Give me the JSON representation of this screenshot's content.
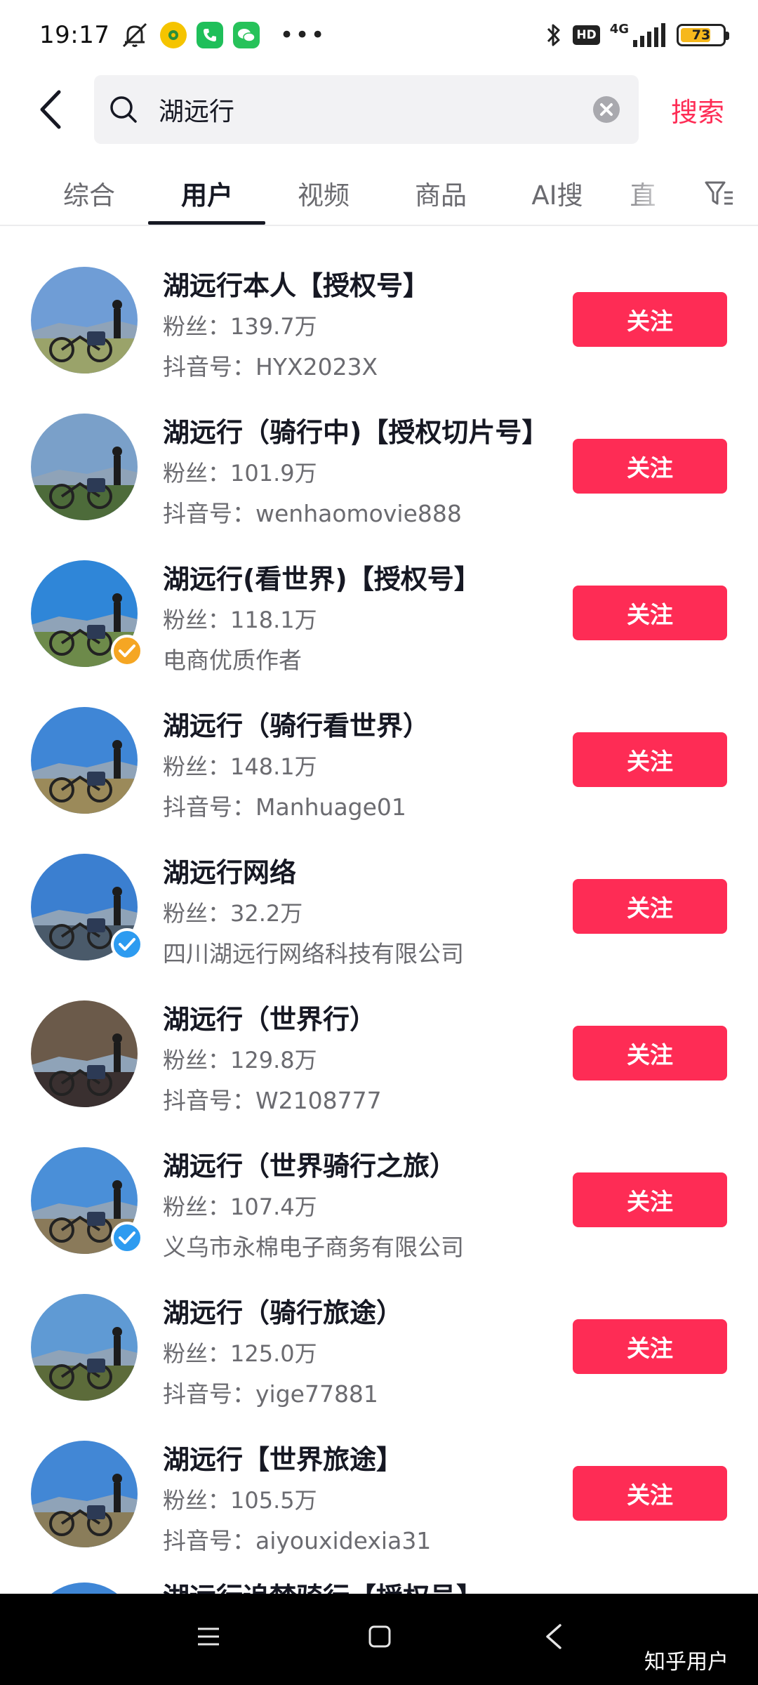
{
  "status_bar": {
    "time": "19:17",
    "network": "4G",
    "battery": "73",
    "battery_level": 0.73,
    "icons": [
      "mute-icon",
      "app-notification-icon",
      "phone-icon",
      "wechat-icon",
      "more-icon",
      "bluetooth-icon",
      "hd-icon",
      "signal-icon",
      "battery-icon"
    ],
    "hd_label": "HD"
  },
  "search": {
    "query": "湖远行",
    "submit_label": "搜索"
  },
  "tabs": [
    {
      "label": "综合"
    },
    {
      "label": "用户"
    },
    {
      "label": "视频"
    },
    {
      "label": "商品"
    },
    {
      "label": "AI搜"
    },
    {
      "label": "直"
    }
  ],
  "active_tab": "用户",
  "follow_label": "关注",
  "users": [
    {
      "name": "湖远行本人【授权号】",
      "fans": "粉丝：139.7万",
      "sub": "抖音号：HYX2023X",
      "verified": null
    },
    {
      "name": "湖远行（骑行中)【授权切片号】",
      "fans": "粉丝：101.9万",
      "sub": "抖音号：wenhaomovie888",
      "verified": null
    },
    {
      "name": "湖远行(看世界)【授权号】",
      "fans": "粉丝：118.1万",
      "sub": "电商优质作者",
      "verified": "orange"
    },
    {
      "name": "湖远行（骑行看世界）",
      "fans": "粉丝：148.1万",
      "sub": "抖音号：Manhuage01",
      "verified": null
    },
    {
      "name": "湖远行网络",
      "fans": "粉丝：32.2万",
      "sub": "四川湖远行网络科技有限公司",
      "verified": "blue"
    },
    {
      "name": "湖远行（世界行）",
      "fans": "粉丝：129.8万",
      "sub": "抖音号：W2108777",
      "verified": null
    },
    {
      "name": "湖远行（世界骑行之旅）",
      "fans": "粉丝：107.4万",
      "sub": "义乌市永棉电子商务有限公司",
      "verified": "blue"
    },
    {
      "name": "湖远行（骑行旅途）",
      "fans": "粉丝：125.0万",
      "sub": "抖音号：yige77881",
      "verified": null
    },
    {
      "name": "湖远行【世界旅途】",
      "fans": "粉丝：105.5万",
      "sub": "抖音号：aiyouxidexia31",
      "verified": null
    }
  ],
  "partial_user": {
    "name": "湖远行追梦骑行【授权号】"
  },
  "colors": {
    "accent": "#fe2c55",
    "verify_blue": "#2d9bf0",
    "verify_orange": "#f5a623"
  },
  "watermark": "知乎用户"
}
